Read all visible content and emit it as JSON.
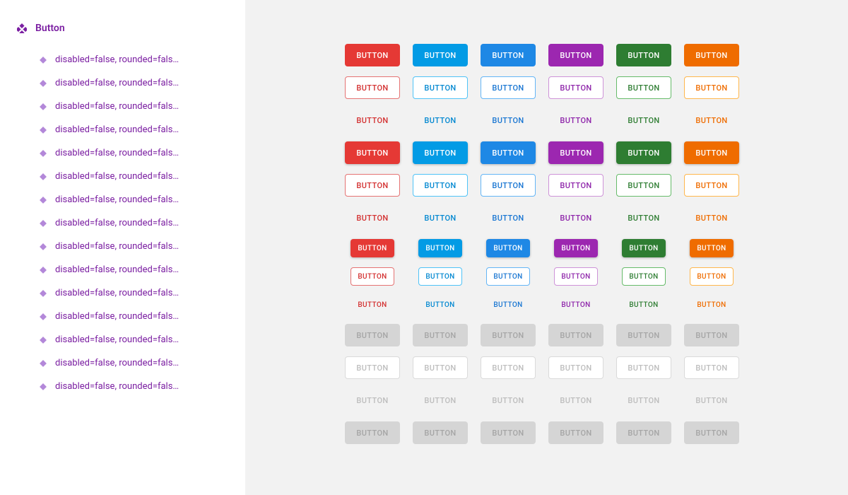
{
  "sidebar": {
    "title": "Button",
    "variant_label": "disabled=false, rounded=fals…",
    "variant_count": 15
  },
  "button_label": "BUTTON",
  "colors": [
    {
      "name": "red",
      "fill": "#e53935",
      "outline": "#e57373",
      "text": "#d32f2f"
    },
    {
      "name": "blue",
      "fill": "#039be5",
      "outline": "#4fc3f7",
      "text": "#0288d1"
    },
    {
      "name": "indigo",
      "fill": "#1e88e5",
      "outline": "#64b5f6",
      "text": "#1976d2"
    },
    {
      "name": "purple",
      "fill": "#9c27b0",
      "outline": "#ce93d8",
      "text": "#8e24aa"
    },
    {
      "name": "green",
      "fill": "#2e7d32",
      "outline": "#66bb6a",
      "text": "#2e7d32"
    },
    {
      "name": "orange",
      "fill": "#ef6c00",
      "outline": "#ffb74d",
      "text": "#ef6c00"
    }
  ],
  "row_styles": [
    {
      "variant": "contained",
      "size": "normal",
      "raised": false,
      "disabled": false
    },
    {
      "variant": "outlined",
      "size": "normal",
      "raised": false,
      "disabled": false
    },
    {
      "variant": "text",
      "size": "normal",
      "raised": false,
      "disabled": false
    },
    {
      "variant": "contained",
      "size": "normal",
      "raised": true,
      "disabled": false
    },
    {
      "variant": "outlined",
      "size": "normal",
      "raised": false,
      "disabled": false
    },
    {
      "variant": "text",
      "size": "normal",
      "raised": false,
      "disabled": false
    },
    {
      "variant": "contained",
      "size": "small",
      "raised": true,
      "disabled": false
    },
    {
      "variant": "outlined",
      "size": "small",
      "raised": false,
      "disabled": false
    },
    {
      "variant": "text",
      "size": "small",
      "raised": false,
      "disabled": false
    },
    {
      "variant": "contained",
      "size": "normal",
      "raised": false,
      "disabled": true
    },
    {
      "variant": "outlined",
      "size": "normal",
      "raised": false,
      "disabled": true
    },
    {
      "variant": "text",
      "size": "normal",
      "raised": false,
      "disabled": true
    },
    {
      "variant": "contained",
      "size": "normal",
      "raised": false,
      "disabled": true
    }
  ]
}
